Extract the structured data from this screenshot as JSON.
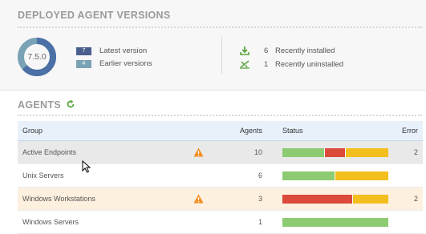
{
  "deployed": {
    "title": "DEPLOYED AGENT VERSIONS",
    "current_version": "7.5.0",
    "donut": {
      "latest_fraction": 0.636,
      "latest_color": "#4a70a6",
      "earlier_color": "#7aa2b5"
    },
    "legend": [
      {
        "count": "7",
        "label": "Latest version",
        "color": "#4a5f8e"
      },
      {
        "count": "4",
        "label": "Earlier versions",
        "color": "#7aa2b5"
      }
    ],
    "recent": [
      {
        "icon": "download-icon",
        "count": "6",
        "label": "Recently installed"
      },
      {
        "icon": "uninstall-icon",
        "count": "1",
        "label": "Recently uninstalled"
      }
    ]
  },
  "agents": {
    "title": "AGENTS",
    "refresh_icon": "refresh-icon",
    "columns": {
      "group": "Group",
      "agents": "Agents",
      "status": "Status",
      "error": "Error"
    },
    "status_colors": {
      "ok": "#8ccb72",
      "error": "#db4a3b",
      "warning": "#f3bf1d"
    },
    "rows": [
      {
        "group": "Active Endpoints",
        "warning": true,
        "agents": "10",
        "error": "2",
        "status": [
          {
            "type": "ok",
            "fraction": 0.4
          },
          {
            "type": "error",
            "fraction": 0.2
          },
          {
            "type": "warning",
            "fraction": 0.4
          }
        ]
      },
      {
        "group": "Unix Servers",
        "warning": false,
        "agents": "6",
        "error": "",
        "status": [
          {
            "type": "ok",
            "fraction": 0.5
          },
          {
            "type": "warning",
            "fraction": 0.5
          }
        ]
      },
      {
        "group": "Windows Workstations",
        "warning": true,
        "agents": "3",
        "error": "2",
        "status": [
          {
            "type": "error",
            "fraction": 0.667
          },
          {
            "type": "warning",
            "fraction": 0.333
          }
        ]
      },
      {
        "group": "Windows Servers",
        "warning": false,
        "agents": "1",
        "error": "",
        "status": [
          {
            "type": "ok",
            "fraction": 1.0
          }
        ]
      }
    ]
  }
}
